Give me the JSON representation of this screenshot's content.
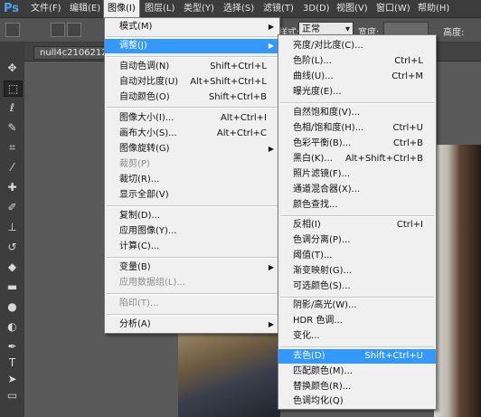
{
  "app": {
    "logo": "Ps"
  },
  "menubar": {
    "items": [
      "文件(F)",
      "编辑(E)",
      "图像(I)",
      "图层(L)",
      "类型(Y)",
      "选择(S)",
      "滤镜(T)",
      "3D(D)",
      "视图(V)",
      "窗口(W)",
      "帮助(H)"
    ],
    "active_index": 2
  },
  "options": {
    "mode_label": "样式:",
    "mode_value": "正常",
    "opacity_label": "宽度:",
    "height_label": "高度:"
  },
  "document": {
    "tab_label": "null4c2106212a3"
  },
  "image_menu": {
    "items": [
      {
        "label": "模式(M)",
        "shortcut": "",
        "submenu": true,
        "disabled": false
      },
      {
        "label": "调整(J)",
        "shortcut": "",
        "submenu": true,
        "disabled": false,
        "highlighted": true
      },
      {
        "label": "自动色调(N)",
        "shortcut": "Shift+Ctrl+L",
        "submenu": false,
        "disabled": false
      },
      {
        "label": "自动对比度(U)",
        "shortcut": "Alt+Shift+Ctrl+L",
        "submenu": false,
        "disabled": false
      },
      {
        "label": "自动颜色(O)",
        "shortcut": "Shift+Ctrl+B",
        "submenu": false,
        "disabled": false
      },
      {
        "label": "图像大小(I)...",
        "shortcut": "Alt+Ctrl+I",
        "submenu": false,
        "disabled": false
      },
      {
        "label": "画布大小(S)...",
        "shortcut": "Alt+Ctrl+C",
        "submenu": false,
        "disabled": false
      },
      {
        "label": "图像旋转(G)",
        "shortcut": "",
        "submenu": true,
        "disabled": false
      },
      {
        "label": "裁剪(P)",
        "shortcut": "",
        "submenu": false,
        "disabled": true
      },
      {
        "label": "裁切(R)...",
        "shortcut": "",
        "submenu": false,
        "disabled": false
      },
      {
        "label": "显示全部(V)",
        "shortcut": "",
        "submenu": false,
        "disabled": false
      },
      {
        "label": "复制(D)...",
        "shortcut": "",
        "submenu": false,
        "disabled": false
      },
      {
        "label": "应用图像(Y)...",
        "shortcut": "",
        "submenu": false,
        "disabled": false
      },
      {
        "label": "计算(C)...",
        "shortcut": "",
        "submenu": false,
        "disabled": false
      },
      {
        "label": "变量(B)",
        "shortcut": "",
        "submenu": true,
        "disabled": false
      },
      {
        "label": "应用数据组(L)...",
        "shortcut": "",
        "submenu": false,
        "disabled": true
      },
      {
        "label": "陷印(T)...",
        "shortcut": "",
        "submenu": false,
        "disabled": true
      },
      {
        "label": "分析(A)",
        "shortcut": "",
        "submenu": true,
        "disabled": false
      }
    ]
  },
  "adjust_menu": {
    "items": [
      {
        "label": "亮度/对比度(C)...",
        "shortcut": ""
      },
      {
        "label": "色阶(L)...",
        "shortcut": "Ctrl+L"
      },
      {
        "label": "曲线(U)...",
        "shortcut": "Ctrl+M"
      },
      {
        "label": "曝光度(E)...",
        "shortcut": ""
      },
      {
        "label": "自然饱和度(V)...",
        "shortcut": ""
      },
      {
        "label": "色相/饱和度(H)...",
        "shortcut": "Ctrl+U"
      },
      {
        "label": "色彩平衡(B)...",
        "shortcut": "Ctrl+B"
      },
      {
        "label": "黑白(K)...",
        "shortcut": "Alt+Shift+Ctrl+B"
      },
      {
        "label": "照片滤镜(F)...",
        "shortcut": ""
      },
      {
        "label": "通道混合器(X)...",
        "shortcut": ""
      },
      {
        "label": "颜色查找...",
        "shortcut": ""
      },
      {
        "label": "反相(I)",
        "shortcut": "Ctrl+I"
      },
      {
        "label": "色调分离(P)...",
        "shortcut": ""
      },
      {
        "label": "阈值(T)...",
        "shortcut": ""
      },
      {
        "label": "渐变映射(G)...",
        "shortcut": ""
      },
      {
        "label": "可选颜色(S)...",
        "shortcut": ""
      },
      {
        "label": "阴影/高光(W)...",
        "shortcut": ""
      },
      {
        "label": "HDR 色调...",
        "shortcut": ""
      },
      {
        "label": "变化...",
        "shortcut": ""
      },
      {
        "label": "去色(D)",
        "shortcut": "Shift+Ctrl+U",
        "highlighted": true
      },
      {
        "label": "匹配颜色(M)...",
        "shortcut": ""
      },
      {
        "label": "替换颜色(R)...",
        "shortcut": ""
      },
      {
        "label": "色调均化(Q)",
        "shortcut": ""
      }
    ]
  },
  "tools": [
    "move-tool-icon",
    "marquee-tool-icon",
    "lasso-tool-icon",
    "quick-select-tool-icon",
    "crop-tool-icon",
    "eyedropper-tool-icon",
    "healing-brush-tool-icon",
    "brush-tool-icon",
    "clone-stamp-tool-icon",
    "history-brush-tool-icon",
    "eraser-tool-icon",
    "gradient-tool-icon",
    "blur-tool-icon",
    "dodge-tool-icon",
    "pen-tool-icon",
    "type-tool-icon",
    "path-select-tool-icon",
    "rectangle-tool-icon",
    "hand-tool-icon"
  ],
  "colors": {
    "highlight": "#3399ff",
    "menu_bg": "#f0f0f0",
    "chrome": "#535353",
    "logo": "#4aa3ef"
  }
}
